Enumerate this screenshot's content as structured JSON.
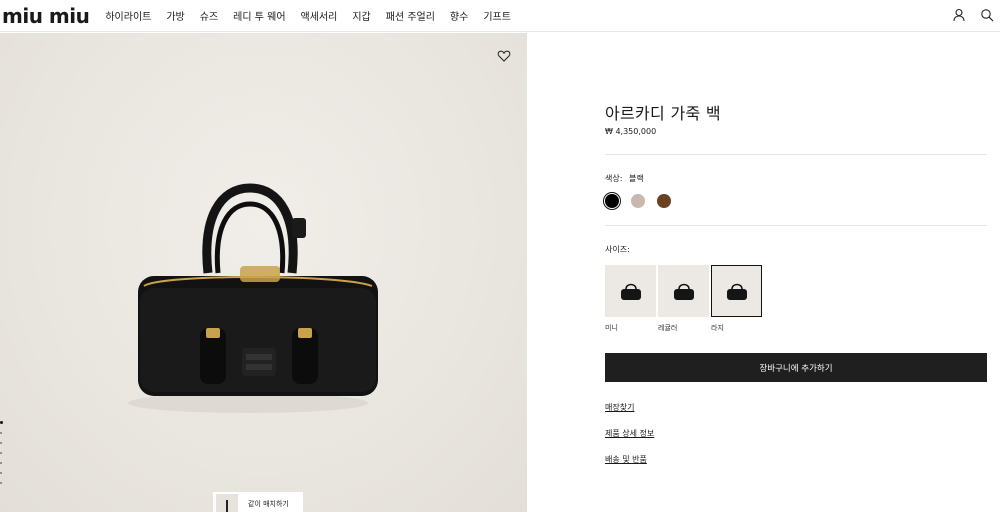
{
  "brand": {
    "logo_text": "miu miu"
  },
  "nav": {
    "items": [
      {
        "label": "하이라이트"
      },
      {
        "label": "가방"
      },
      {
        "label": "슈즈"
      },
      {
        "label": "레디 투 웨어"
      },
      {
        "label": "액세서리"
      },
      {
        "label": "지갑"
      },
      {
        "label": "패션 주얼리"
      },
      {
        "label": "향수"
      },
      {
        "label": "기프트"
      }
    ]
  },
  "header_icons": [
    "user-icon",
    "search-icon"
  ],
  "gallery": {
    "wishlist_icon": "heart-icon",
    "match_button_label": "같이 매치하기",
    "slide_count": 7,
    "active_slide": 1
  },
  "product": {
    "title": "아르카디 가죽 백",
    "price": "₩ 4,350,000",
    "color": {
      "label": "색상:",
      "selected_name": "블랙",
      "options": [
        {
          "hex": "#000000",
          "selected": true
        },
        {
          "hex": "#c8b9b0",
          "selected": false
        },
        {
          "hex": "#6b4221",
          "selected": false
        }
      ]
    },
    "size": {
      "label": "사이즈:",
      "options": [
        {
          "label": "미니",
          "selected": false
        },
        {
          "label": "레귤러",
          "selected": false
        },
        {
          "label": "라지",
          "selected": true
        }
      ]
    },
    "add_to_cart_label": "장바구니에 추가하기",
    "links": {
      "store": "매장찾기",
      "details": "제품 상세 정보",
      "shipping": "배송 및 반품"
    }
  }
}
